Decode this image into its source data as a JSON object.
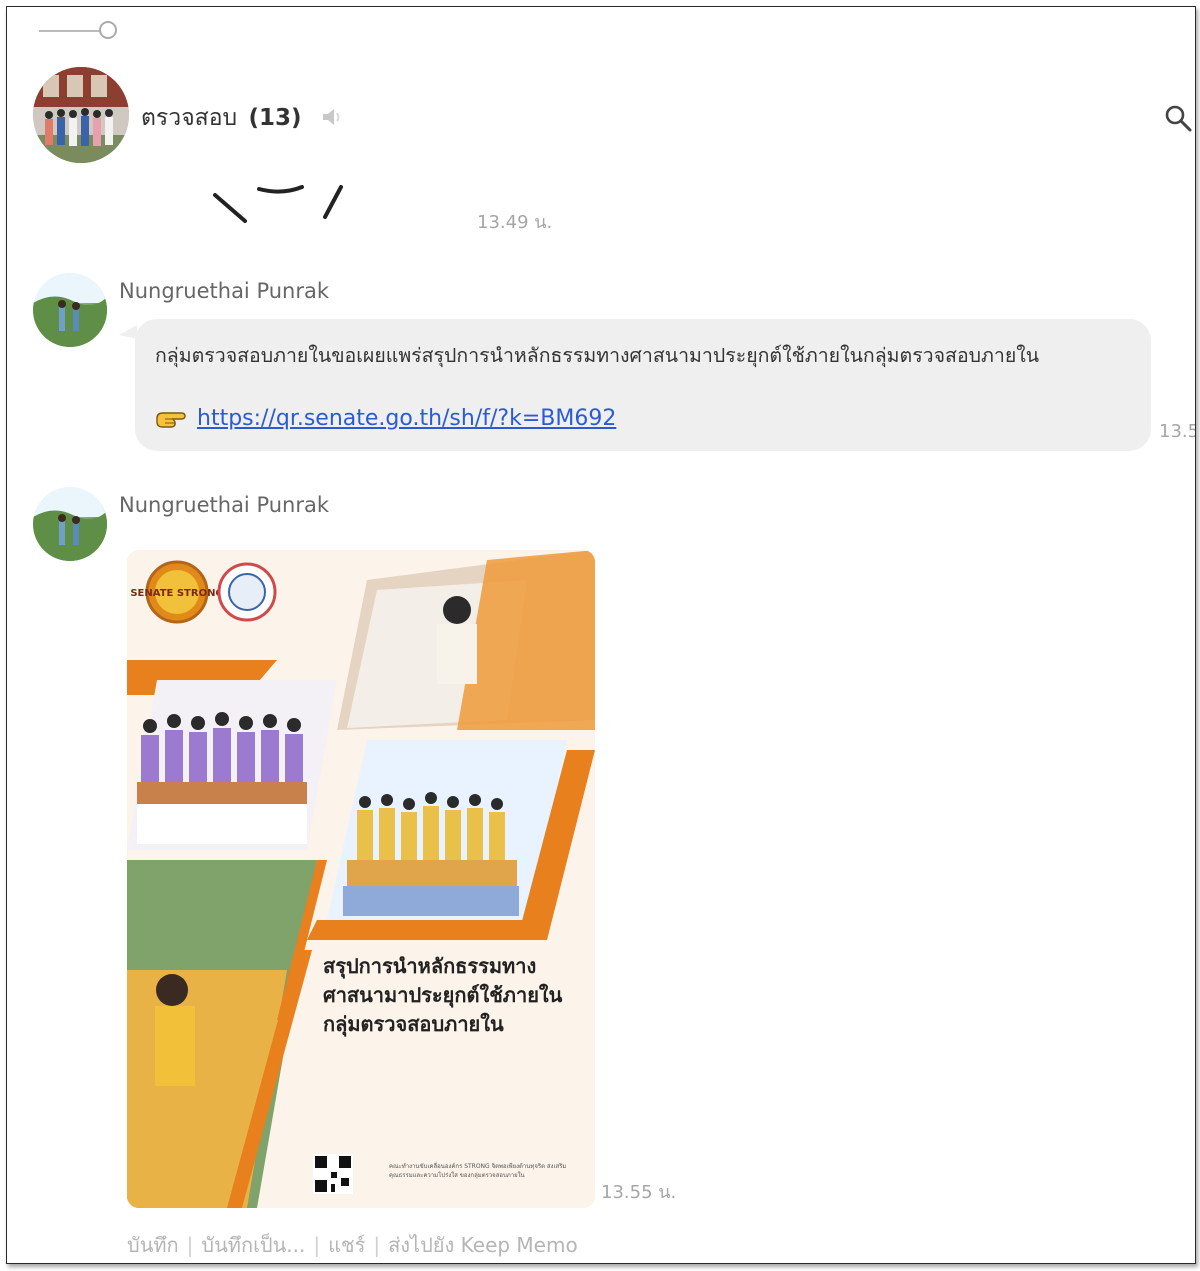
{
  "chat": {
    "name": "ตรวจสอบ",
    "member_count": "(13)"
  },
  "messages": [
    {
      "time": "13.49 น."
    },
    {
      "sender": "Nungruethai Punrak",
      "text": "กลุ่มตรวจสอบภายในขอเผยแพร่สรุปการนำหลักธรรมทางศาสนามาประยุกต์ใช้ภายในกลุ่มตรวจสอบภายใน",
      "link": "https://qr.senate.go.th/sh/f/?k=BM692",
      "time": "13.5"
    },
    {
      "sender": "Nungruethai Punrak",
      "poster_title": [
        "สรุปการนำหลักธรรมทาง",
        "ศาสนามาประยุกต์ใช้ภายใน",
        "กลุ่มตรวจสอบภายใน"
      ],
      "poster_badge": "SENATE STRONG",
      "poster_footer": "คณะทำงานขับเคลื่อนองค์กร STRONG จิตพอเพียงต้านทุจริต ส่งเสริมคุณธรรมและความโปร่งใส ของกลุ่มตรวจสอบภายใน",
      "time": "13.55 น."
    }
  ],
  "image_actions": [
    "บันทึก",
    "บันทึกเป็น...",
    "แชร์",
    "ส่งไปยัง Keep Memo"
  ],
  "colors": {
    "accent": "#e8801e",
    "link": "#2a5bd7",
    "bubble": "#efefef"
  },
  "icons": [
    "mute-icon",
    "search-icon",
    "pointing-hand-icon",
    "qr-code-icon"
  ]
}
